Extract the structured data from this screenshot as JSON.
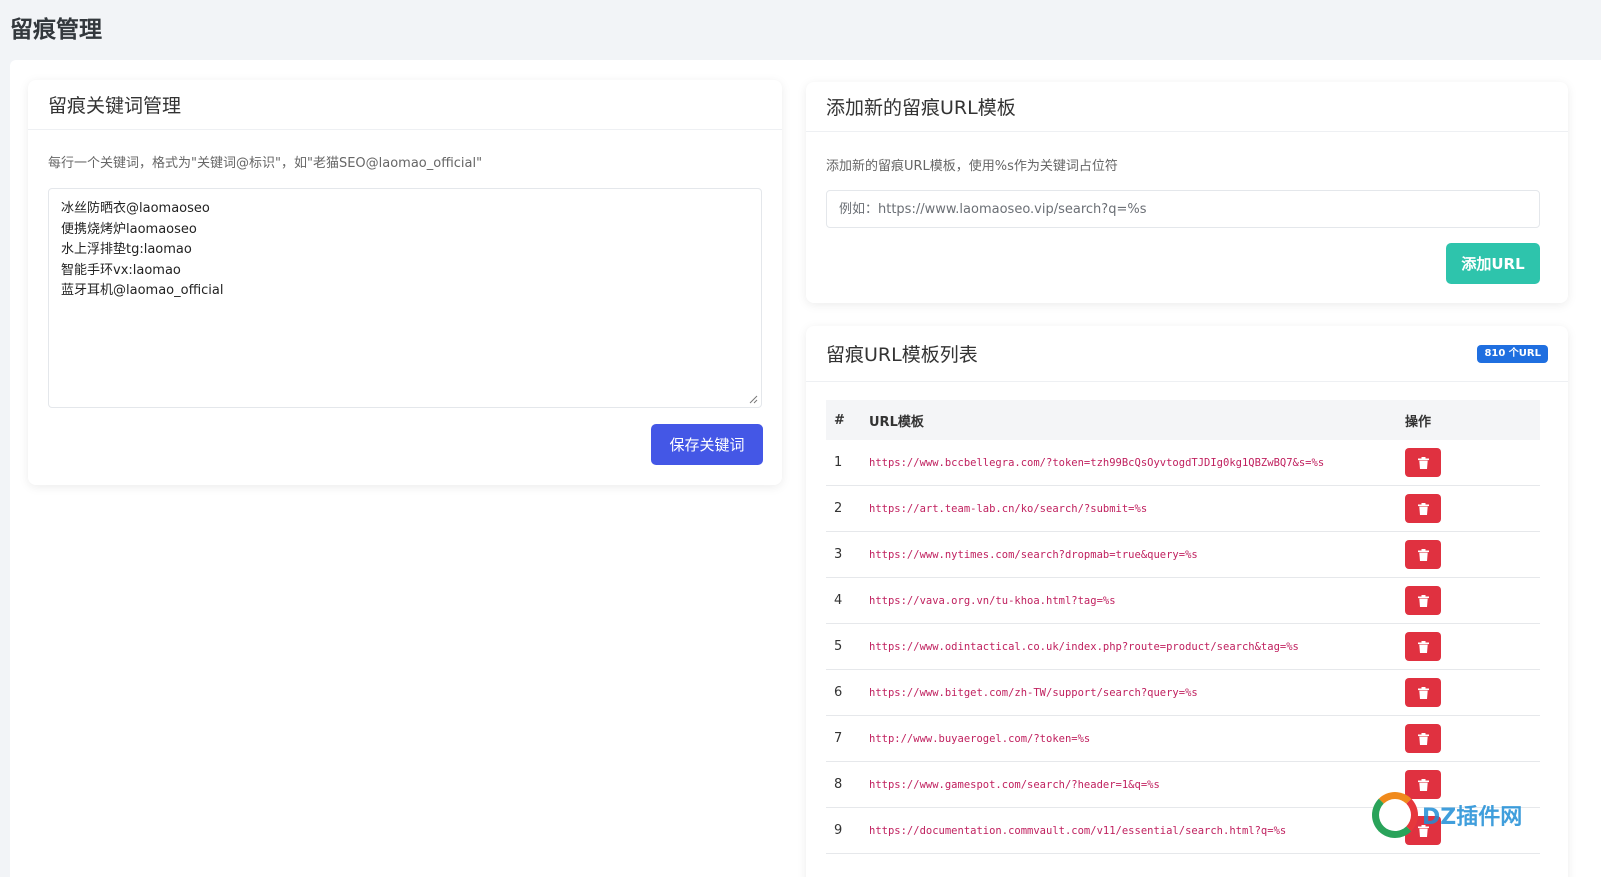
{
  "page": {
    "title": "留痕管理"
  },
  "keywords": {
    "title": "留痕关键词管理",
    "hint": "每行一个关键词，格式为\"关键词@标识\"，如\"老猫SEO@laomao_official\"",
    "value": "冰丝防晒衣@laomaoseo\n便携烧烤炉laomaoseo\n水上浮排垫tg:laomao\n智能手环vx:laomao\n蓝牙耳机@laomao_official",
    "save_label": "保存关键词"
  },
  "add_url": {
    "title": "添加新的留痕URL模板",
    "hint": "添加新的留痕URL模板，使用%s作为关键词占位符",
    "placeholder": "例如：https://www.laomaoseo.vip/search?q=%s",
    "button_label": "添加URL"
  },
  "url_list": {
    "title": "留痕URL模板列表",
    "count_badge": "810 个URL",
    "headers": {
      "num": "#",
      "url": "URL模板",
      "op": "操作"
    },
    "rows": [
      {
        "num": "1",
        "url": "https://www.bccbellegra.com/?token=tzh99BcQsOyvtogdTJDIg0kg1QBZwBQ7&s=%s"
      },
      {
        "num": "2",
        "url": "https://art.team-lab.cn/ko/search/?submit=%s"
      },
      {
        "num": "3",
        "url": "https://www.nytimes.com/search?dropmab=true&query=%s"
      },
      {
        "num": "4",
        "url": "https://vava.org.vn/tu-khoa.html?tag=%s"
      },
      {
        "num": "5",
        "url": "https://www.odintactical.co.uk/index.php?route=product/search&tag=%s"
      },
      {
        "num": "6",
        "url": "https://www.bitget.com/zh-TW/support/search?query=%s"
      },
      {
        "num": "7",
        "url": "http://www.buyaerogel.com/?token=%s"
      },
      {
        "num": "8",
        "url": "https://www.gamespot.com/search/?header=1&q=%s"
      },
      {
        "num": "9",
        "url": "https://documentation.commvault.com/v11/essential/search.html?q=%s"
      }
    ],
    "delete_icon": "trash-icon",
    "delete_color": "#e03140"
  },
  "watermark": {
    "text": "DZ插件网"
  },
  "colors": {
    "primary": "#4457e6",
    "success": "#2ec4ac",
    "badge": "#1f6fe0",
    "danger": "#e03140",
    "code": "#c0215f"
  }
}
